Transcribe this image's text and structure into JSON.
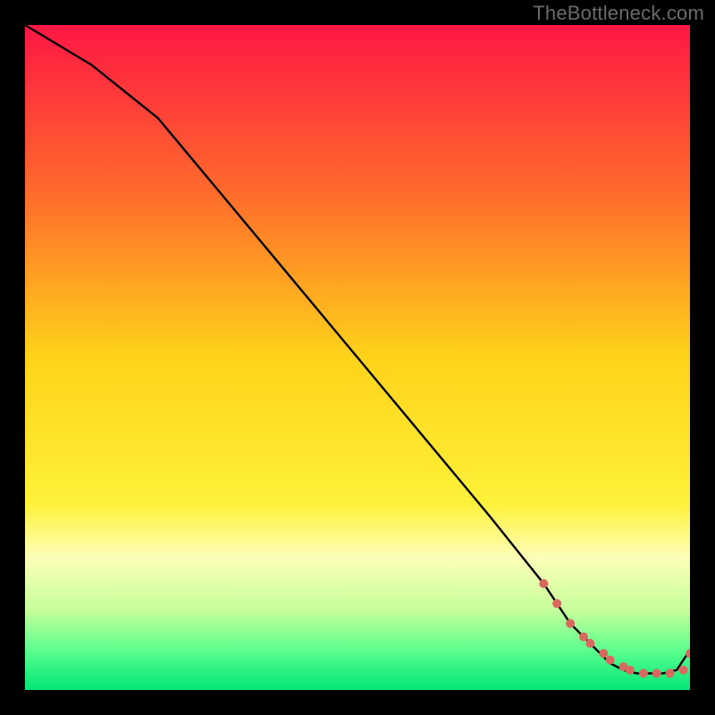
{
  "watermark": "TheBottleneck.com",
  "chart_data": {
    "type": "line",
    "title": "",
    "xlabel": "",
    "ylabel": "",
    "xlim": [
      0,
      100
    ],
    "ylim": [
      0,
      100
    ],
    "grid": false,
    "legend": false,
    "gradient_stops": [
      {
        "offset": 0.0,
        "color": "#ff1744"
      },
      {
        "offset": 0.25,
        "color": "#ff6a2c"
      },
      {
        "offset": 0.5,
        "color": "#ffd31a"
      },
      {
        "offset": 0.72,
        "color": "#fff13a"
      },
      {
        "offset": 0.8,
        "color": "#fdffb8"
      },
      {
        "offset": 0.88,
        "color": "#c6ff9a"
      },
      {
        "offset": 0.94,
        "color": "#5cff8e"
      },
      {
        "offset": 1.0,
        "color": "#00e676"
      }
    ],
    "series": [
      {
        "name": "bottleneck-curve",
        "color": "#000000",
        "x": [
          0,
          10,
          20,
          25,
          30,
          40,
          50,
          60,
          70,
          78,
          82,
          86,
          88,
          90,
          92,
          94,
          96,
          98,
          100
        ],
        "y": [
          100,
          94,
          86,
          80,
          74,
          62,
          50,
          38,
          26,
          16,
          10,
          6,
          4,
          3,
          2.5,
          2.5,
          2.5,
          3,
          6
        ]
      }
    ],
    "markers": {
      "name": "tail-dots",
      "color": "#d9695f",
      "radius_px": 5,
      "x": [
        78,
        80,
        82,
        84,
        85,
        87,
        88,
        90,
        91,
        93,
        95,
        97,
        99,
        100
      ],
      "y": [
        16,
        13,
        10,
        8,
        7,
        5.5,
        4.5,
        3.5,
        3,
        2.5,
        2.5,
        2.5,
        3,
        5.5
      ]
    }
  }
}
